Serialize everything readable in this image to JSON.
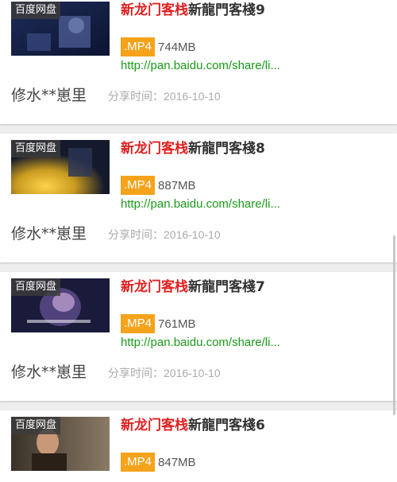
{
  "source_badge": "百度网盘",
  "items": [
    {
      "title_highlight": "新龙门客栈",
      "title_rest": "新龍門客棧9",
      "ext": ".MP4",
      "size": "744MB",
      "link": "http://pan.baidu.com/share/li...",
      "user": "修水**崽里",
      "share_label": "分享时间：",
      "share_date": "2016-10-10"
    },
    {
      "title_highlight": "新龙门客栈",
      "title_rest": "新龍門客棧8",
      "ext": ".MP4",
      "size": "887MB",
      "link": "http://pan.baidu.com/share/li...",
      "user": "修水**崽里",
      "share_label": "分享时间：",
      "share_date": "2016-10-10"
    },
    {
      "title_highlight": "新龙门客栈",
      "title_rest": "新龍門客棧7",
      "ext": ".MP4",
      "size": "761MB",
      "link": "http://pan.baidu.com/share/li...",
      "user": "修水**崽里",
      "share_label": "分享时间：",
      "share_date": "2016-10-10"
    },
    {
      "title_highlight": "新龙门客栈",
      "title_rest": "新龍門客棧6",
      "ext": ".MP4",
      "size": "847MB",
      "link": "",
      "user": "",
      "share_label": "",
      "share_date": ""
    }
  ],
  "colors": {
    "title_highlight": "#e02020",
    "ext_badge": "#f5a31a",
    "link": "#1a9a1a"
  }
}
